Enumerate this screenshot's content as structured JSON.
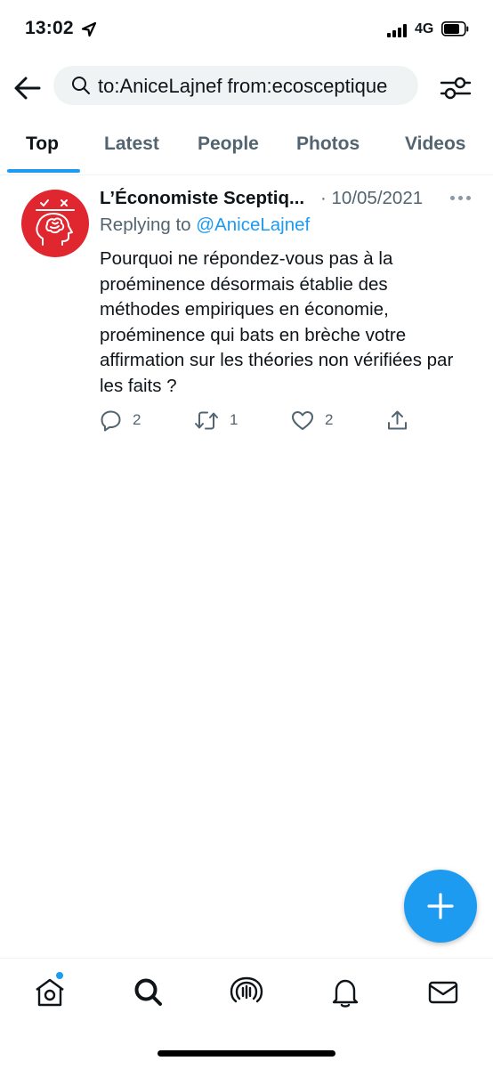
{
  "status_bar": {
    "time": "13:02",
    "network": "4G",
    "icons": [
      "location-arrow-icon",
      "signal-bars-icon",
      "battery-icon"
    ]
  },
  "search": {
    "query": "to:AniceLajnef from:ecosceptique",
    "icons": [
      "back-arrow-icon",
      "search-icon",
      "filter-sliders-icon"
    ]
  },
  "tabs": [
    {
      "label": "Top",
      "active": true
    },
    {
      "label": "Latest",
      "active": false
    },
    {
      "label": "People",
      "active": false
    },
    {
      "label": "Photos",
      "active": false
    },
    {
      "label": "Videos",
      "active": false
    }
  ],
  "tweet": {
    "author": "L’Économiste Sceptiq...",
    "separator": "·",
    "date": "10/05/2021",
    "replying_prefix": "Replying to",
    "replying_handle": "@AniceLajnef",
    "text": "Pourquoi ne répondez-vous pas à la proéminence désormais établie des méthodes empiriques en économie, proéminence qui bats en brèche votre affirmation sur les théories non vérifiées par les faits ?",
    "replies": "2",
    "retweets": "1",
    "likes": "2",
    "icons": [
      "more-icon",
      "reply-icon",
      "retweet-icon",
      "like-icon",
      "share-icon"
    ]
  },
  "fab": {
    "icon": "compose-plus-icon"
  },
  "bottom_nav": {
    "items": [
      "home-icon",
      "search-icon",
      "spaces-icon",
      "notifications-icon",
      "messages-icon"
    ],
    "home_has_badge": true
  },
  "colors": {
    "accent": "#1d9bf0",
    "text_primary": "#0f1419",
    "text_secondary": "#536471",
    "avatar_bg": "#e0262f",
    "search_bg": "#eff3f4"
  }
}
